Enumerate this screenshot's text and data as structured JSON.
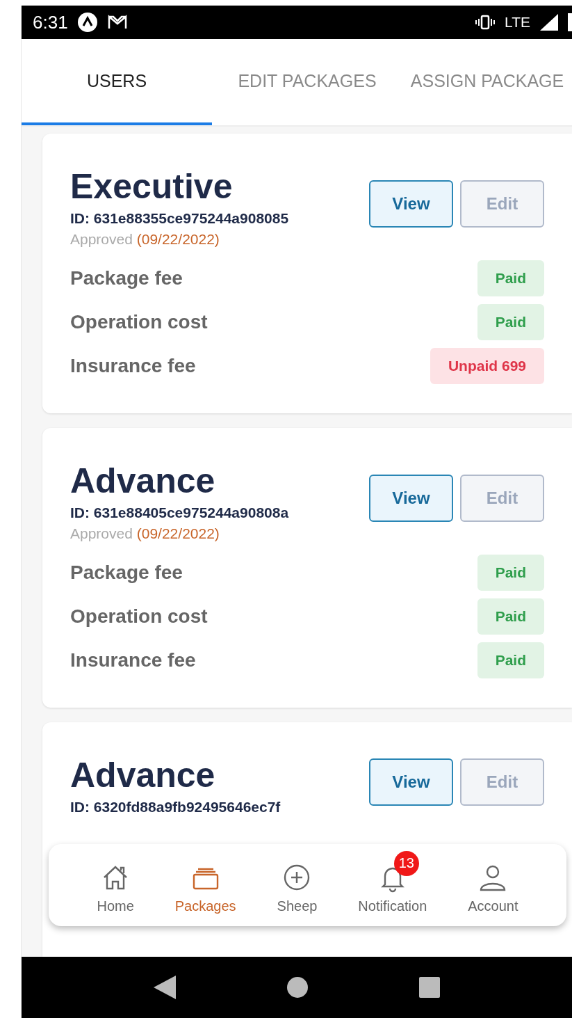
{
  "status_bar": {
    "time": "6:31",
    "network": "LTE"
  },
  "tabs": [
    {
      "label": "USERS",
      "selected": true
    },
    {
      "label": "EDIT PACKAGES",
      "selected": false
    },
    {
      "label": "ASSIGN PACKAGE",
      "selected": false
    }
  ],
  "packages": [
    {
      "title": "Executive",
      "id": "ID: 631e88355ce975244a908085",
      "approved_label": "Approved",
      "approved_date": "(09/22/2022)",
      "buttons": [
        {
          "label": "View",
          "kind": "primary"
        },
        {
          "label": "Edit",
          "kind": "secondary"
        }
      ],
      "fees": [
        {
          "label": "Package fee",
          "kind": "paid",
          "badge": "Paid"
        },
        {
          "label": "Operation cost",
          "kind": "paid",
          "badge": "Paid"
        },
        {
          "label": "Insurance fee",
          "kind": "unpaid",
          "badge": "Unpaid 699"
        }
      ]
    },
    {
      "title": "Advance",
      "id": "ID: 631e88405ce975244a90808a",
      "approved_label": "Approved",
      "approved_date": "(09/22/2022)",
      "buttons": [
        {
          "label": "View",
          "kind": "primary"
        },
        {
          "label": "Edit",
          "kind": "secondary"
        }
      ],
      "fees": [
        {
          "label": "Package fee",
          "kind": "paid",
          "badge": "Paid"
        },
        {
          "label": "Operation cost",
          "kind": "paid",
          "badge": "Paid"
        },
        {
          "label": "Insurance fee",
          "kind": "paid",
          "badge": "Paid"
        }
      ]
    },
    {
      "title": "Advance",
      "id": "ID: 6320fd88a9fb92495646ec7f",
      "buttons": [
        {
          "label": "View",
          "kind": "primary"
        },
        {
          "label": "Edit",
          "kind": "secondary"
        }
      ]
    }
  ],
  "bottom_nav": [
    {
      "label": "Home",
      "selected": false
    },
    {
      "label": "Packages",
      "selected": true
    },
    {
      "label": "Sheep",
      "selected": false
    },
    {
      "label": "Notification",
      "selected": false,
      "badge": "13"
    },
    {
      "label": "Account",
      "selected": false
    }
  ]
}
